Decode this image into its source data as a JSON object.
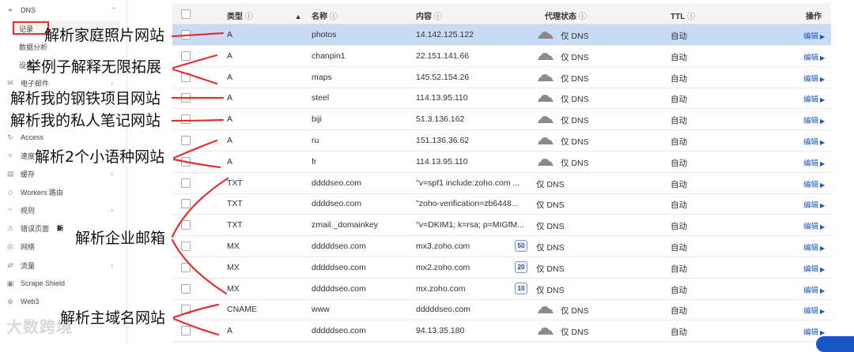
{
  "sidebar": {
    "dns_label": "DNS",
    "records_label": "记录",
    "analytics_label": "数据分析",
    "settings_label": "设置",
    "email_label": "电子邮件",
    "access_label": "Access",
    "speed_label": "速度",
    "cache_label": "缓存",
    "workers_label": "Workers 路由",
    "rules_label": "规则",
    "error_pages_label": "错误页面",
    "new_badge": "新",
    "network_label": "网络",
    "traffic_label": "流量",
    "scrape_label": "Scrape Shield",
    "web3_label": "Web3"
  },
  "watermark": "大数跨境",
  "table": {
    "headers": {
      "type": "类型",
      "name": "名称",
      "content": "内容",
      "proxy": "代理状态",
      "ttl": "TTL",
      "action": "操作"
    },
    "sort_indicator": "▲",
    "info_glyph": "ⓘ",
    "rows": [
      {
        "type": "A",
        "name": "photos",
        "content": "14.142.125.122",
        "proxy": "仅 DNS",
        "cloud": true,
        "prio": "",
        "ttl": "自动",
        "edit": "编辑"
      },
      {
        "type": "A",
        "name": "chanpin1",
        "content": "22.151.141.66",
        "proxy": "仅 DNS",
        "cloud": true,
        "prio": "",
        "ttl": "自动",
        "edit": "编辑"
      },
      {
        "type": "A",
        "name": "maps",
        "content": "145.52.154.26",
        "proxy": "仅 DNS",
        "cloud": true,
        "prio": "",
        "ttl": "自动",
        "edit": "编辑"
      },
      {
        "type": "A",
        "name": "steel",
        "content": "114.13.95.110",
        "proxy": "仅 DNS",
        "cloud": true,
        "prio": "",
        "ttl": "自动",
        "edit": "编辑"
      },
      {
        "type": "A",
        "name": "biji",
        "content": "51.3.136.162",
        "proxy": "仅 DNS",
        "cloud": true,
        "prio": "",
        "ttl": "自动",
        "edit": "编辑"
      },
      {
        "type": "A",
        "name": "ru",
        "content": "151.136.36.62",
        "proxy": "仅 DNS",
        "cloud": true,
        "prio": "",
        "ttl": "自动",
        "edit": "编辑"
      },
      {
        "type": "A",
        "name": "fr",
        "content": "114.13.95.110",
        "proxy": "仅 DNS",
        "cloud": true,
        "prio": "",
        "ttl": "自动",
        "edit": "编辑"
      },
      {
        "type": "TXT",
        "name": "ddddseo.com",
        "content": "\"v=spf1 include:zoho.com ...",
        "proxy": "仅 DNS",
        "cloud": false,
        "prio": "",
        "ttl": "自动",
        "edit": "编辑"
      },
      {
        "type": "TXT",
        "name": "ddddseo.com",
        "content": "\"zoho-verification=zb6448...",
        "proxy": "仅 DNS",
        "cloud": false,
        "prio": "",
        "ttl": "自动",
        "edit": "编辑"
      },
      {
        "type": "TXT",
        "name": "zmail._domainkey",
        "content": "\"v=DKIM1; k=rsa; p=MIGfM...",
        "proxy": "仅 DNS",
        "cloud": false,
        "prio": "",
        "ttl": "自动",
        "edit": "编辑"
      },
      {
        "type": "MX",
        "name": "dddddseo.com",
        "content": "mx3.zoho.com",
        "proxy": "仅 DNS",
        "cloud": false,
        "prio": "50",
        "ttl": "自动",
        "edit": "编辑"
      },
      {
        "type": "MX",
        "name": "dddddseo.com",
        "content": "mx2.zoho.com",
        "proxy": "仅 DNS",
        "cloud": false,
        "prio": "20",
        "ttl": "自动",
        "edit": "编辑"
      },
      {
        "type": "MX",
        "name": "dddddseo.com",
        "content": "mx.zoho.com",
        "proxy": "仅 DNS",
        "cloud": false,
        "prio": "10",
        "ttl": "自动",
        "edit": "编辑"
      },
      {
        "type": "CNAME",
        "name": "www",
        "content": "dddddseo.com",
        "proxy": "仅 DNS",
        "cloud": true,
        "prio": "",
        "ttl": "自动",
        "edit": "编辑"
      },
      {
        "type": "A",
        "name": "dddddseo.com",
        "content": "94.13.35.180",
        "proxy": "仅 DNS",
        "cloud": true,
        "prio": "",
        "ttl": "自动",
        "edit": "编辑"
      }
    ]
  },
  "annotations": {
    "a1": "解析家庭照片网站",
    "a2": "举例子解释无限拓展",
    "a3": "解析我的钢铁项目网站",
    "a4": "解析我的私人笔记网站",
    "a5": "解析2个小语种网站",
    "a6": "解析企业邮箱",
    "a7": "解析主域名网站"
  },
  "colors": {
    "selected_row": "#c9dcf5",
    "annotation_red": "#e03030",
    "link_blue": "#1a55c4"
  }
}
